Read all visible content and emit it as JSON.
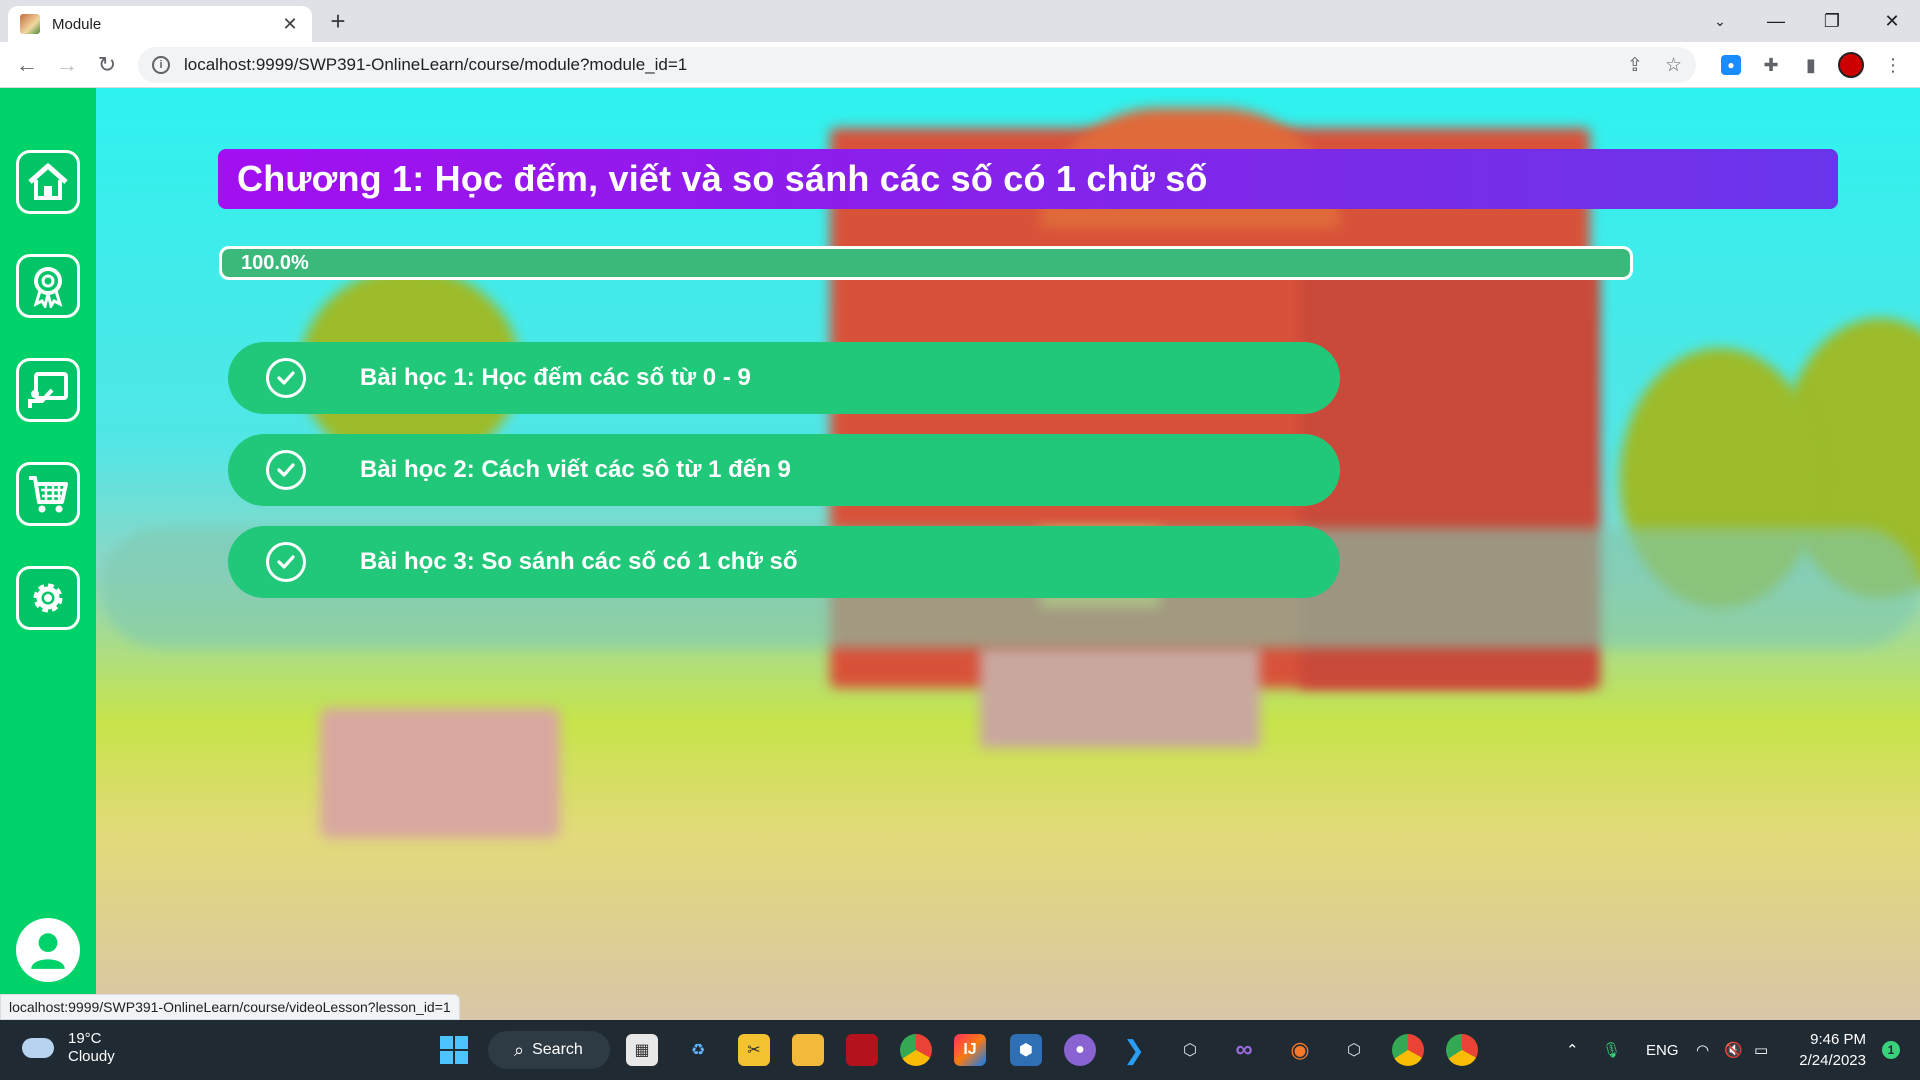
{
  "browser": {
    "tab_title": "Module",
    "new_tab": "+",
    "url": "localhost:9999/SWP391-OnlineLearn/course/module?module_id=1",
    "status_url": "localhost:9999/SWP391-OnlineLearn/course/videoLesson?lesson_id=1"
  },
  "module": {
    "title": "Chương 1: Học đếm, viết và so sánh các số có 1 chữ số",
    "progress_label": "100.0%",
    "progress_value": 100.0,
    "lessons": [
      {
        "label": "Bài học 1: Học đếm các số từ 0 - 9",
        "completed": true
      },
      {
        "label": "Bài học 2: Cách viết các sô từ 1 đến 9",
        "completed": true
      },
      {
        "label": "Bài học 3: So sánh các số có 1 chữ số",
        "completed": true
      }
    ]
  },
  "sidebar": {
    "items": [
      "home-icon",
      "award-icon",
      "teaching-icon",
      "cart-icon",
      "settings-icon",
      "user-icon"
    ]
  },
  "taskbar": {
    "weather_temp": "19°C",
    "weather_desc": "Cloudy",
    "search_label": "Search",
    "lang": "ENG",
    "time": "9:46 PM",
    "date": "2/24/2023",
    "notifications": "1"
  },
  "colors": {
    "sidebar": "#00d26a",
    "header_start": "#a20ff0",
    "header_end": "#6a35ea",
    "lesson": "#22c87a",
    "progress": "#3ab97a"
  }
}
